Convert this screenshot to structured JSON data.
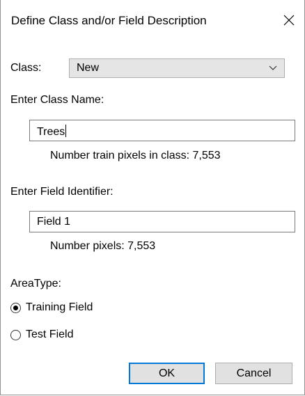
{
  "window": {
    "title": "Define Class and/or Field Description",
    "close_icon": "close-icon"
  },
  "class_selector": {
    "label": "Class:",
    "selected": "New"
  },
  "class_name": {
    "label": "Enter Class Name:",
    "value": "Trees"
  },
  "train_pixels": {
    "text": "Number train pixels in class: 7,553"
  },
  "field_identifier": {
    "label": "Enter Field Identifier:",
    "value": "Field 1"
  },
  "field_pixels": {
    "text": "Number pixels: 7,553"
  },
  "area_type": {
    "label": "AreaType:",
    "options": [
      {
        "label": "Training Field",
        "selected": true
      },
      {
        "label": "Test Field",
        "selected": false
      }
    ]
  },
  "buttons": {
    "ok": "OK",
    "cancel": "Cancel"
  },
  "colors": {
    "accent": "#0078d7",
    "button_bg": "#e1e1e1",
    "combo_bg": "#e5e5e5"
  }
}
